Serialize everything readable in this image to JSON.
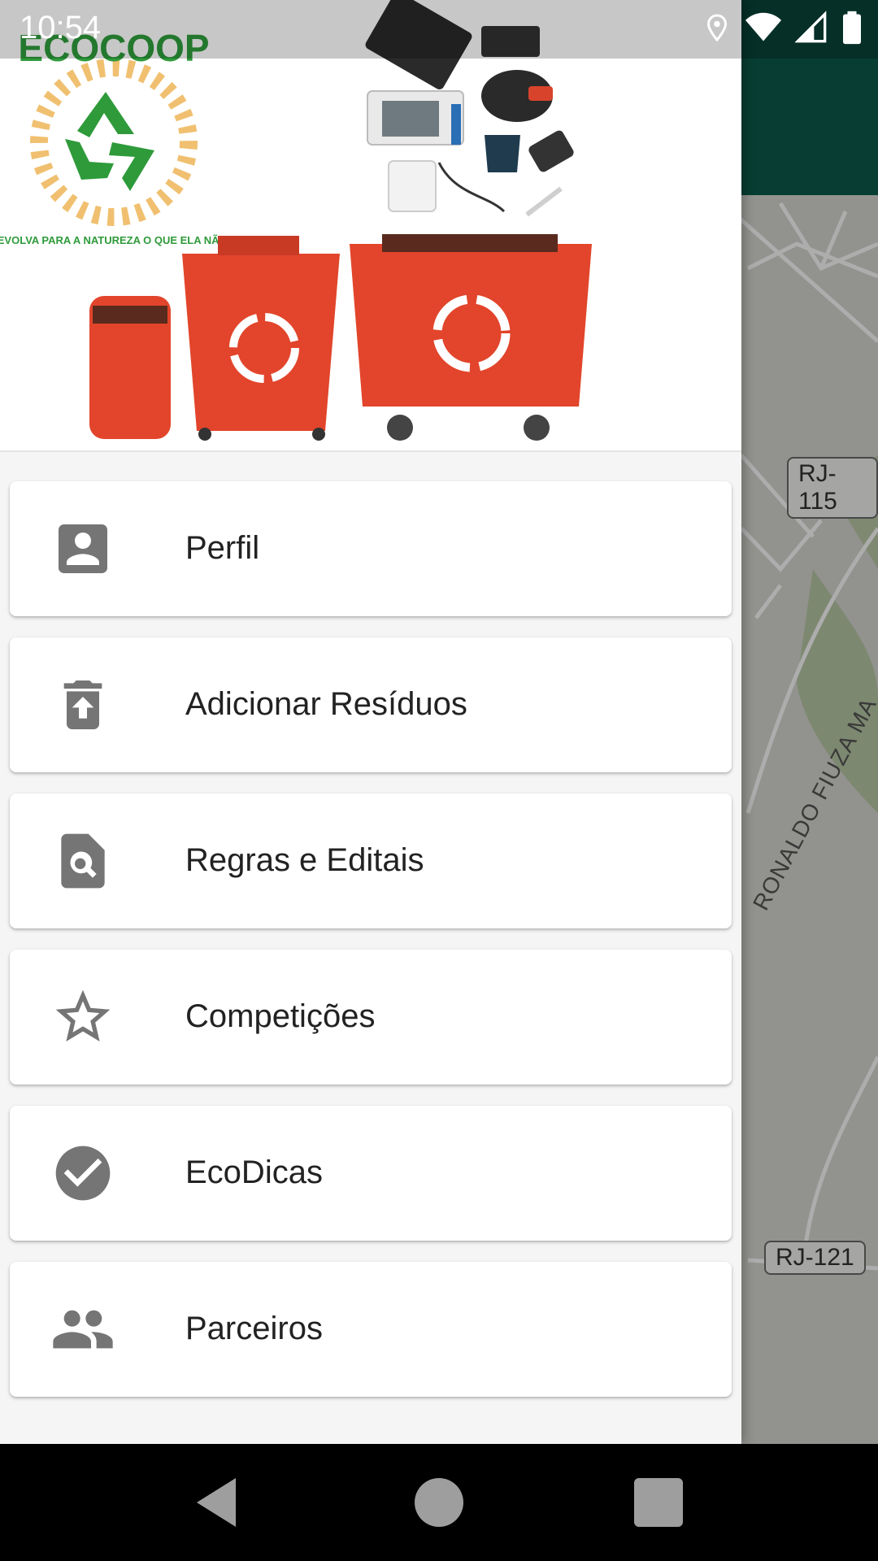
{
  "status_bar": {
    "time": "10:54"
  },
  "drawer": {
    "header": {
      "logo_text": "ECOCOOP",
      "logo_slogan": "NÃO DEVOLVA PARA A NATUREZA O QUE ELA NÃO CRIOU"
    },
    "menu_items": [
      {
        "label": "Perfil",
        "icon": "account-box-icon"
      },
      {
        "label": "Adicionar Resíduos",
        "icon": "trash-upload-icon"
      },
      {
        "label": "Regras e Editais",
        "icon": "document-search-icon"
      },
      {
        "label": "Competições",
        "icon": "star-outline-icon"
      },
      {
        "label": "EcoDicas",
        "icon": "check-circle-icon"
      },
      {
        "label": "Parceiros",
        "icon": "people-icon"
      }
    ]
  },
  "map": {
    "road_labels": [
      "RJ-115",
      "RJ-121"
    ],
    "street_label": "RONALDO FIUZA MA"
  },
  "colors": {
    "app_bar": "#0b5a4a",
    "icon_gray": "#757575",
    "bin_red": "#e2452b",
    "logo_green": "#2e9a3a"
  }
}
